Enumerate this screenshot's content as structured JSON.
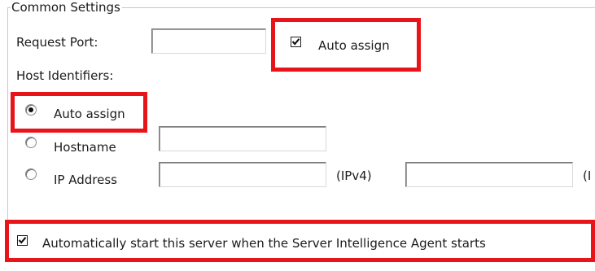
{
  "group": {
    "title": "Common Settings"
  },
  "request_port": {
    "label": "Request Port:",
    "value": "",
    "auto_assign": {
      "label": "Auto assign",
      "checked": true
    }
  },
  "host_identifiers": {
    "label": "Host Identifiers:",
    "options": [
      {
        "label": "Auto assign",
        "selected": true
      },
      {
        "label": "Hostname",
        "selected": false,
        "value": ""
      },
      {
        "label": "IP Address",
        "selected": false,
        "ipv4_value": "",
        "ipv4_suffix": "(IPv4)",
        "ipv6_value": "",
        "ipv6_suffix": "(I"
      }
    ]
  },
  "auto_start": {
    "label": "Automatically start this server when the Server Intelligence Agent starts",
    "checked": true
  },
  "colors": {
    "highlight": "#e8141a"
  }
}
